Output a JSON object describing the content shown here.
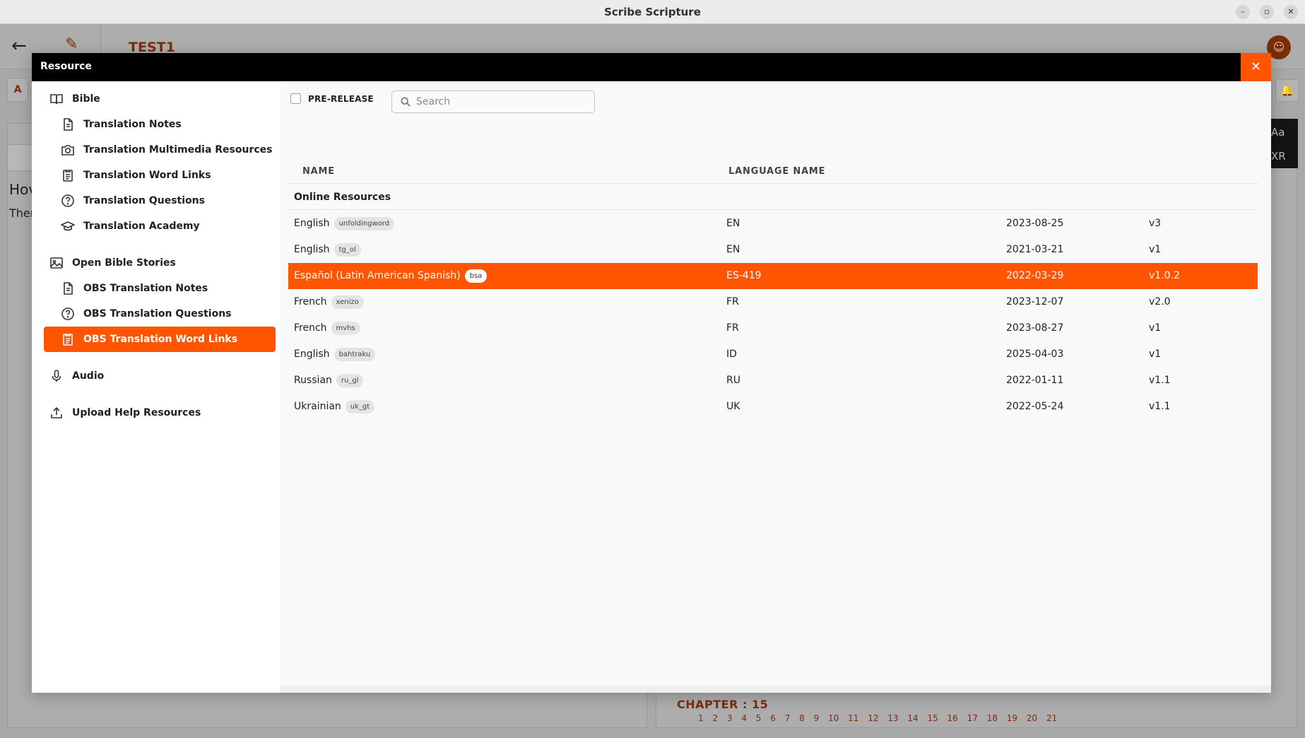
{
  "window": {
    "title": "Scribe Scripture",
    "controls": [
      "–",
      "▫",
      "✕"
    ]
  },
  "background": {
    "project_name": "TEST1",
    "tab_letter": "A",
    "partial_heading": "Hov",
    "partial_text": "Ther",
    "side_tools": [
      "Aa",
      "XR"
    ],
    "chapter_label": "CHAPTER : 15",
    "verses": "1 2 3 4 5 6 7 8 9 10 11 12 13 14 15 16 17 18 19 20 21"
  },
  "modal": {
    "title": "Resource",
    "close_symbol": "✕"
  },
  "sidebar": {
    "items": [
      {
        "label": "Bible",
        "icon": "book-icon",
        "level": "top"
      },
      {
        "label": "Translation Notes",
        "icon": "document-icon",
        "level": "sub"
      },
      {
        "label": "Translation Multimedia Resources",
        "icon": "camera-icon",
        "level": "sub"
      },
      {
        "label": "Translation Word Links",
        "icon": "clipboard-icon",
        "level": "sub"
      },
      {
        "label": "Translation Questions",
        "icon": "question-circle-icon",
        "level": "sub"
      },
      {
        "label": "Translation Academy",
        "icon": "graduation-cap-icon",
        "level": "sub"
      },
      {
        "label": "Open Bible Stories",
        "icon": "image-icon",
        "level": "top"
      },
      {
        "label": "OBS Translation Notes",
        "icon": "document-icon",
        "level": "sub"
      },
      {
        "label": "OBS Translation Questions",
        "icon": "question-circle-icon",
        "level": "sub"
      },
      {
        "label": "OBS Translation Word Links",
        "icon": "clipboard-icon",
        "level": "sub",
        "active": true
      },
      {
        "label": "Audio",
        "icon": "microphone-icon",
        "level": "top"
      },
      {
        "label": "Upload Help Resources",
        "icon": "upload-icon",
        "level": "top"
      }
    ]
  },
  "toolbar": {
    "prerelease_label": "PRE-RELEASE",
    "search_placeholder": "Search"
  },
  "table": {
    "headers": {
      "name": "NAME",
      "language": "LANGUAGE NAME"
    },
    "section_label": "Online Resources",
    "rows": [
      {
        "name": "English",
        "tag": "unfoldingword",
        "code": "EN",
        "date": "2023-08-25",
        "version": "v3"
      },
      {
        "name": "English",
        "tag": "tg_ol",
        "code": "EN",
        "date": "2021-03-21",
        "version": "v1"
      },
      {
        "name": "Español (Latin American Spanish)",
        "tag": "bsa",
        "code": "ES-419",
        "date": "2022-03-29",
        "version": "v1.0.2",
        "selected": true
      },
      {
        "name": "French",
        "tag": "xenizo",
        "code": "FR",
        "date": "2023-12-07",
        "version": "v2.0"
      },
      {
        "name": "French",
        "tag": "mvhs",
        "code": "FR",
        "date": "2023-08-27",
        "version": "v1"
      },
      {
        "name": "English",
        "tag": "bahtraku",
        "code": "ID",
        "date": "2025-04-03",
        "version": "v1"
      },
      {
        "name": "Russian",
        "tag": "ru_gl",
        "code": "RU",
        "date": "2022-01-11",
        "version": "v1.1"
      },
      {
        "name": "Ukrainian",
        "tag": "uk_gt",
        "code": "UK",
        "date": "2022-05-24",
        "version": "v1.1"
      }
    ]
  },
  "colors": {
    "accent": "#ff5500",
    "modal_header": "#000000"
  }
}
